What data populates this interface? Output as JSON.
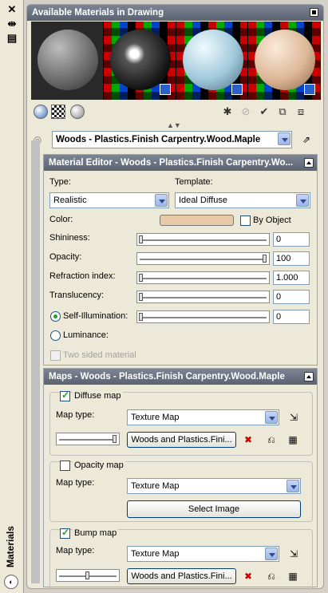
{
  "palette": {
    "title": "Materials",
    "header": "Available Materials in Drawing"
  },
  "current_material": "Woods - Plastics.Finish Carpentry.Wood.Maple",
  "editor": {
    "header": "Material Editor - Woods - Plastics.Finish Carpentry.Wo...",
    "type_label": "Type:",
    "type_value": "Realistic",
    "template_label": "Template:",
    "template_value": "Ideal Diffuse",
    "color_label": "Color:",
    "color_hex": "#e9c9a6",
    "by_object_label": "By Object",
    "shininess_label": "Shininess:",
    "shininess_value": "0",
    "shininess_level": 0,
    "opacity_label": "Opacity:",
    "opacity_value": "100",
    "opacity_level": 1,
    "refraction_label": "Refraction index:",
    "refraction_value": "1.000",
    "refraction_level": 0,
    "translucency_label": "Translucency:",
    "translucency_value": "0",
    "translucency_level": 0,
    "self_illum_label": "Self-Illumination:",
    "self_illum_value": "0",
    "self_illum_level": 0,
    "luminance_label": "Luminance:",
    "two_sided_label": "Two sided material"
  },
  "maps": {
    "header": "Maps - Woods - Plastics.Finish Carpentry.Wood.Maple",
    "diffuse": {
      "label": "Diffuse map",
      "maptype_label": "Map type:",
      "maptype_value": "Texture Map",
      "file": "Woods and Plastics.Fini...",
      "level": 1
    },
    "opacity": {
      "label": "Opacity map",
      "maptype_label": "Map type:",
      "maptype_value": "Texture Map",
      "button": "Select Image"
    },
    "bump": {
      "label": "Bump map",
      "maptype_label": "Map type:",
      "maptype_value": "Texture Map",
      "file": "Woods and Plastics.Fini...",
      "level": 0.5
    }
  }
}
